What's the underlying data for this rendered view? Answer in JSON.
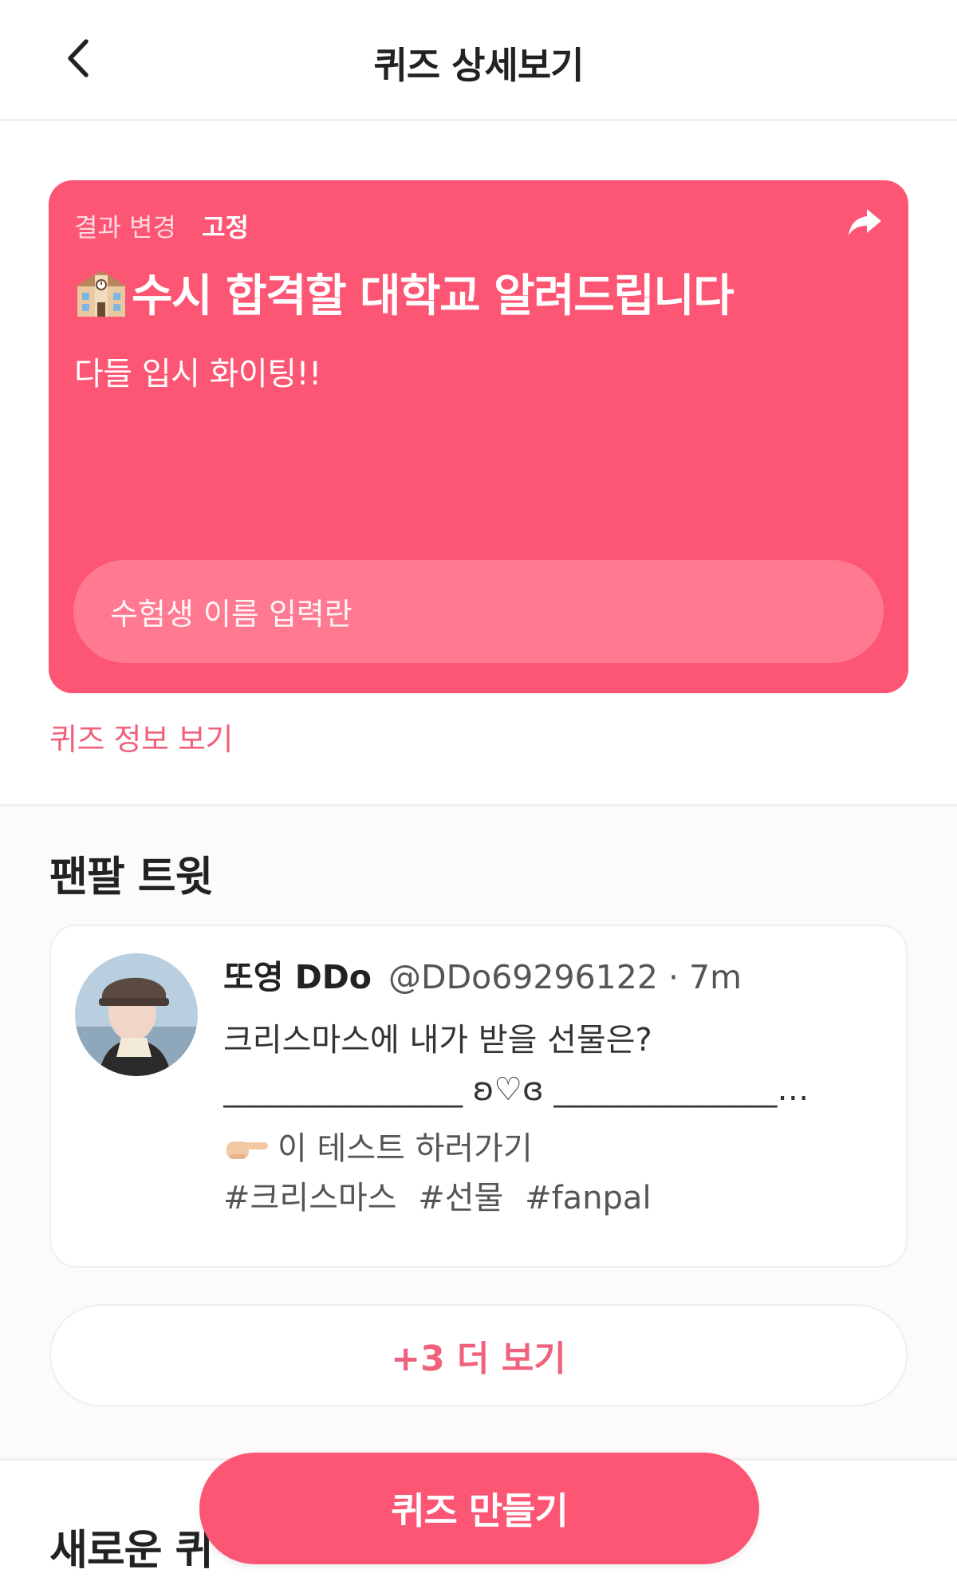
{
  "header": {
    "title": "퀴즈 상세보기",
    "back_icon": "chevron-left-icon"
  },
  "quiz": {
    "tag_result_change": "결과 변경",
    "tag_fixed": "고정",
    "share_icon": "share-arrow-icon",
    "title_icon": "school-building-icon",
    "title": "수시 합격할 대학교 알려드립니다",
    "subtitle": "다들 입시 화이팅!!",
    "input_placeholder": "수험생 이름 입력란",
    "info_link": "퀴즈 정보 보기",
    "accent_color": "#fd5574"
  },
  "tweets": {
    "section_title": "팬팔 트윗",
    "items": [
      {
        "name": "또영 DDo",
        "handle": "@DDo69296122 · 7m",
        "line1": "크리스마스에 내가 받을 선물은?",
        "line2": "_______________ ʚ♡ɞ ______________…",
        "cta": "이 테스트 하러가기",
        "cta_icon": "pointing-finger-icon",
        "hashtags": [
          "#크리스마스",
          "#선물",
          "#fanpal"
        ]
      }
    ],
    "more_label": "+3 더 보기"
  },
  "new_quiz": {
    "section_title": "새로운 퀴"
  },
  "fab": {
    "label": "퀴즈 만들기"
  }
}
